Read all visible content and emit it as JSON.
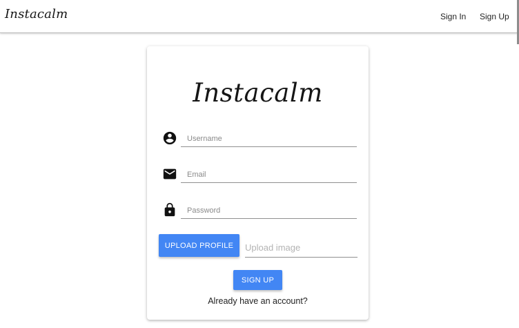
{
  "navbar": {
    "brand": "Instacalm",
    "links": [
      {
        "label": "Sign In"
      },
      {
        "label": "Sign Up"
      }
    ]
  },
  "card": {
    "logo": "Instacalm",
    "fields": {
      "username": {
        "placeholder": "Username",
        "value": "",
        "icon": "account-circle-icon"
      },
      "email": {
        "placeholder": "Email",
        "value": "",
        "icon": "mail-icon"
      },
      "password": {
        "placeholder": "Password",
        "value": "",
        "icon": "lock-icon"
      }
    },
    "upload_button": "UPLOAD PROFILE",
    "upload_placeholder": "Upload image",
    "signup_button": "SIGN UP",
    "have_account": "Already have an account?"
  },
  "colors": {
    "accent": "#4286f4",
    "text": "#151515"
  }
}
